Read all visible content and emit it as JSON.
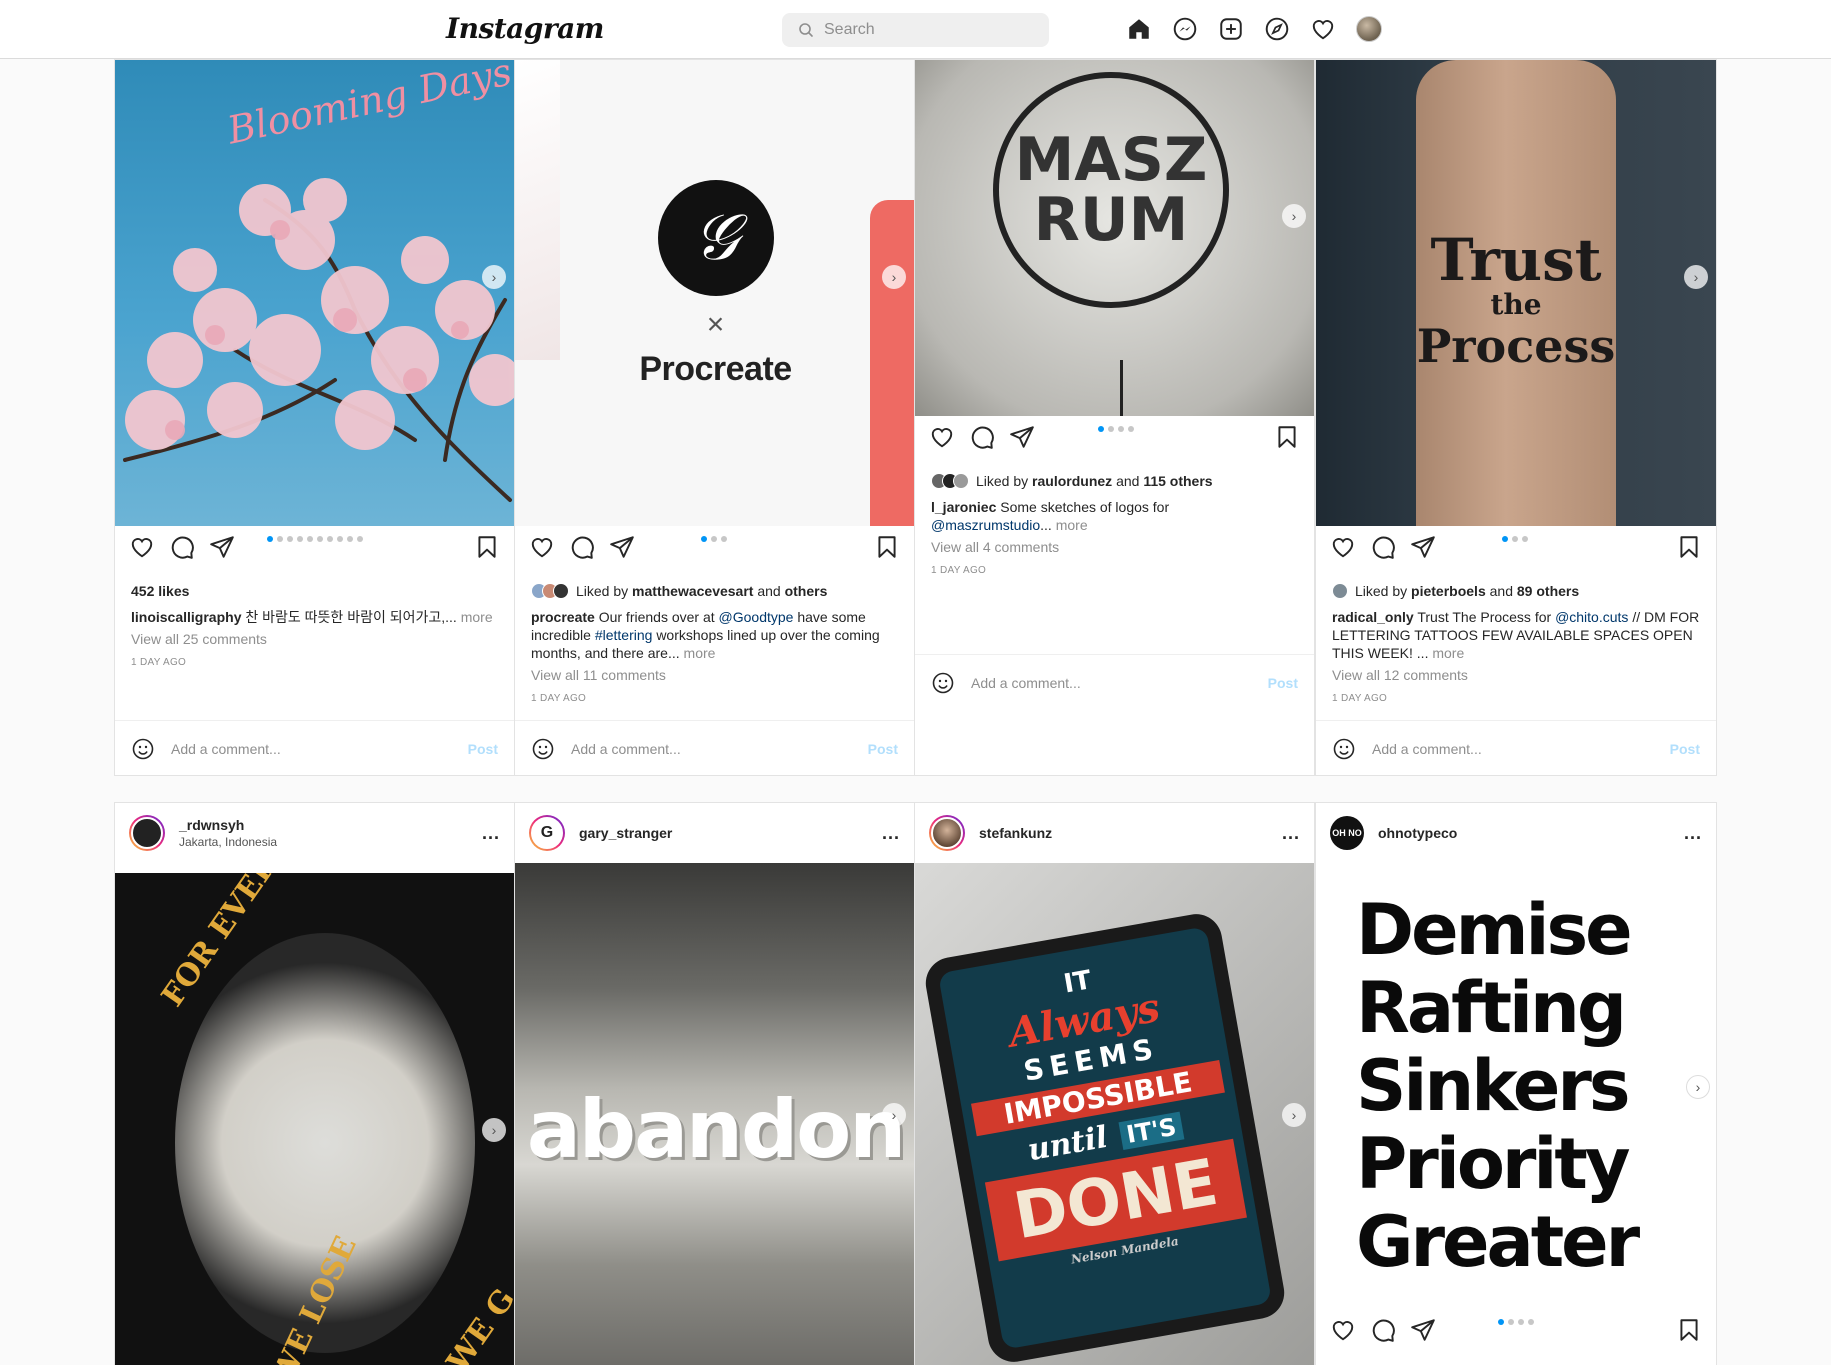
{
  "nav": {
    "logo": "Instagram",
    "search_placeholder": "Search",
    "icons": [
      "home-icon",
      "messenger-icon",
      "new-post-icon",
      "explore-icon",
      "activity-heart-icon",
      "profile-avatar"
    ]
  },
  "posts_top": [
    {
      "image_text": "Blooming Days",
      "likes": "452 likes",
      "username": "linoiscalligraphy",
      "caption": "찬 바람도 따뜻한 바람이 되어가고,...",
      "more": "more",
      "view_comments": "View all 25 comments",
      "time": "1 DAY AGO",
      "comment_placeholder": "Add a comment...",
      "post_label": "Post",
      "carousel_count": 10,
      "carousel_active": 0
    },
    {
      "image_text": "Procreate",
      "image_symbol": "×",
      "liked_by_prefix": "Liked by",
      "liked_by_user": "matthewacevesart",
      "liked_by_and": "and",
      "liked_by_rest": "others",
      "username": "procreate",
      "caption_1": "Our friends over at",
      "caption_mention": "@Goodtype",
      "caption_2": "have some incredible",
      "caption_tag": "#lettering",
      "caption_3": "workshops lined up over the coming months, and there are...",
      "more": "more",
      "view_comments": "View all 11 comments",
      "time": "1 DAY AGO",
      "comment_placeholder": "Add a comment...",
      "post_label": "Post",
      "carousel_count": 3,
      "carousel_active": 0
    },
    {
      "image_text": "MASZ RUM",
      "liked_by_prefix": "Liked by",
      "liked_by_user": "raulordunez",
      "liked_by_and": "and",
      "liked_by_rest": "115 others",
      "username": "l_jaroniec",
      "caption_1": "Some sketches of logos for",
      "caption_mention": "@maszrumstudio",
      "caption_2": "...",
      "more": "more",
      "view_comments": "View all 4 comments",
      "time": "1 DAY AGO",
      "comment_placeholder": "Add a comment...",
      "post_label": "Post",
      "carousel_count": 4,
      "carousel_active": 0
    },
    {
      "image_text_1": "Trust",
      "image_text_2": "the",
      "image_text_3": "Process",
      "liked_by_prefix": "Liked by",
      "liked_by_user": "pieterboels",
      "liked_by_and": "and",
      "liked_by_rest": "89 others",
      "username": "radical_only",
      "caption_1": "Trust The Process for",
      "caption_mention": "@chito.cuts",
      "caption_2": "// DM FOR LETTERING TATTOOS FEW AVAILABLE SPACES OPEN THIS WEEK! ...",
      "more": "more",
      "view_comments": "View all 12 comments",
      "time": "1 DAY AGO",
      "comment_placeholder": "Add a comment...",
      "post_label": "Post",
      "carousel_count": 3,
      "carousel_active": 0
    }
  ],
  "posts_bottom": [
    {
      "username": "_rdwnsyh",
      "location": "Jakarta, Indonesia",
      "more": "...",
      "image_text_1": "FOR EVERYTHING",
      "image_text_2": "WE LOSE",
      "image_text_3": "WE G"
    },
    {
      "username": "gary_stranger",
      "more": "...",
      "image_text": "abandon"
    },
    {
      "username": "stefankunz",
      "more": "...",
      "image_text_1": "IT",
      "image_text_2": "Always",
      "image_text_3": "SEEMS",
      "image_text_4": "IMPOSSIBLE",
      "image_text_5": "until",
      "image_text_6": "IT'S",
      "image_text_7": "DONE",
      "image_text_8": "Nelson Mandela"
    },
    {
      "username": "ohnotypeco",
      "avatar_text": "OH NO",
      "more": "...",
      "image_lines": [
        "Demise",
        "Rafting",
        "Sinkers",
        "Priority",
        "Greater"
      ],
      "carousel_count": 4,
      "carousel_active": 0
    }
  ],
  "colors": {
    "accent": "#0095f6",
    "post_disabled": "#b2dffc",
    "link": "#00376b",
    "muted": "#8e8e8e"
  }
}
